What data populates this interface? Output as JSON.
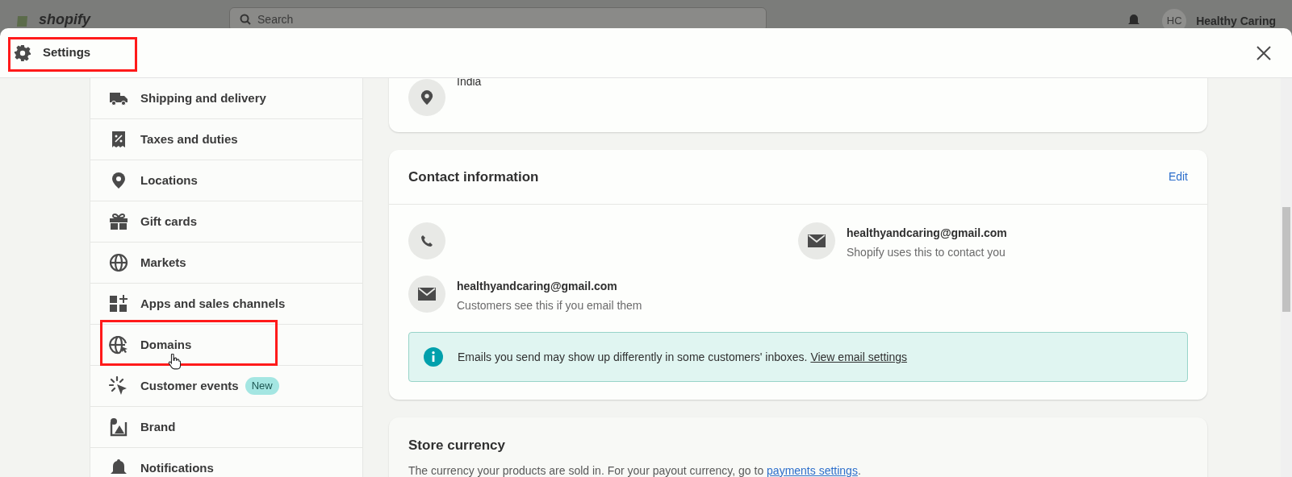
{
  "backdrop": {
    "logo": "shopify",
    "search_placeholder": "Search",
    "avatar_initials": "HC",
    "store_name": "Healthy Caring"
  },
  "modal": {
    "title": "Settings",
    "highlighted": true
  },
  "sidebar": {
    "items": [
      {
        "label": "Shipping and delivery",
        "highlighted": false
      },
      {
        "label": "Taxes and duties",
        "highlighted": false
      },
      {
        "label": "Locations",
        "highlighted": false
      },
      {
        "label": "Gift cards",
        "highlighted": false
      },
      {
        "label": "Markets",
        "highlighted": false
      },
      {
        "label": "Apps and sales channels",
        "highlighted": false
      },
      {
        "label": "Domains",
        "highlighted": true
      },
      {
        "label": "Customer events",
        "badge": "New",
        "highlighted": false
      },
      {
        "label": "Brand",
        "highlighted": false
      },
      {
        "label": "Notifications",
        "highlighted": false
      }
    ]
  },
  "address_card": {
    "country": "India"
  },
  "contact_card": {
    "title": "Contact information",
    "action": "Edit",
    "entries": [
      {
        "kind": "phone"
      },
      {
        "kind": "email",
        "value": "healthyandcaring@gmail.com",
        "note": "Shopify uses this to contact you"
      },
      {
        "kind": "email",
        "value": "healthyandcaring@gmail.com",
        "note": "Customers see this if you email them"
      }
    ],
    "banner": {
      "text": "Emails you send may show up differently in some customers' inboxes.",
      "link": "View email settings"
    }
  },
  "currency_card": {
    "title": "Store currency",
    "text": "The currency your products are sold in. For your payout currency, go to",
    "link": "payments settings",
    "after_link": "."
  }
}
